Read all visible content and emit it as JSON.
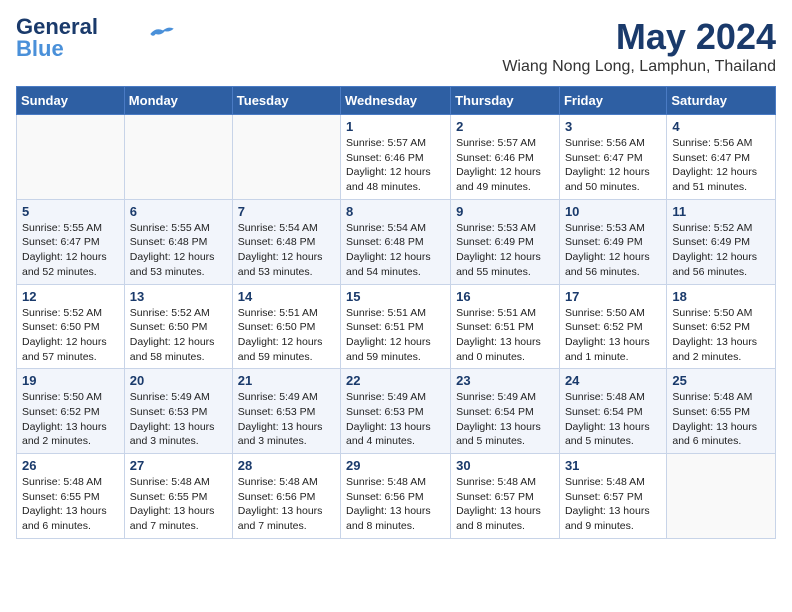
{
  "logo": {
    "line1": "General",
    "line2": "Blue"
  },
  "title": "May 2024",
  "location": "Wiang Nong Long, Lamphun, Thailand",
  "weekdays": [
    "Sunday",
    "Monday",
    "Tuesday",
    "Wednesday",
    "Thursday",
    "Friday",
    "Saturday"
  ],
  "weeks": [
    [
      {
        "day": "",
        "info": ""
      },
      {
        "day": "",
        "info": ""
      },
      {
        "day": "",
        "info": ""
      },
      {
        "day": "1",
        "info": "Sunrise: 5:57 AM\nSunset: 6:46 PM\nDaylight: 12 hours\nand 48 minutes."
      },
      {
        "day": "2",
        "info": "Sunrise: 5:57 AM\nSunset: 6:46 PM\nDaylight: 12 hours\nand 49 minutes."
      },
      {
        "day": "3",
        "info": "Sunrise: 5:56 AM\nSunset: 6:47 PM\nDaylight: 12 hours\nand 50 minutes."
      },
      {
        "day": "4",
        "info": "Sunrise: 5:56 AM\nSunset: 6:47 PM\nDaylight: 12 hours\nand 51 minutes."
      }
    ],
    [
      {
        "day": "5",
        "info": "Sunrise: 5:55 AM\nSunset: 6:47 PM\nDaylight: 12 hours\nand 52 minutes."
      },
      {
        "day": "6",
        "info": "Sunrise: 5:55 AM\nSunset: 6:48 PM\nDaylight: 12 hours\nand 53 minutes."
      },
      {
        "day": "7",
        "info": "Sunrise: 5:54 AM\nSunset: 6:48 PM\nDaylight: 12 hours\nand 53 minutes."
      },
      {
        "day": "8",
        "info": "Sunrise: 5:54 AM\nSunset: 6:48 PM\nDaylight: 12 hours\nand 54 minutes."
      },
      {
        "day": "9",
        "info": "Sunrise: 5:53 AM\nSunset: 6:49 PM\nDaylight: 12 hours\nand 55 minutes."
      },
      {
        "day": "10",
        "info": "Sunrise: 5:53 AM\nSunset: 6:49 PM\nDaylight: 12 hours\nand 56 minutes."
      },
      {
        "day": "11",
        "info": "Sunrise: 5:52 AM\nSunset: 6:49 PM\nDaylight: 12 hours\nand 56 minutes."
      }
    ],
    [
      {
        "day": "12",
        "info": "Sunrise: 5:52 AM\nSunset: 6:50 PM\nDaylight: 12 hours\nand 57 minutes."
      },
      {
        "day": "13",
        "info": "Sunrise: 5:52 AM\nSunset: 6:50 PM\nDaylight: 12 hours\nand 58 minutes."
      },
      {
        "day": "14",
        "info": "Sunrise: 5:51 AM\nSunset: 6:50 PM\nDaylight: 12 hours\nand 59 minutes."
      },
      {
        "day": "15",
        "info": "Sunrise: 5:51 AM\nSunset: 6:51 PM\nDaylight: 12 hours\nand 59 minutes."
      },
      {
        "day": "16",
        "info": "Sunrise: 5:51 AM\nSunset: 6:51 PM\nDaylight: 13 hours\nand 0 minutes."
      },
      {
        "day": "17",
        "info": "Sunrise: 5:50 AM\nSunset: 6:52 PM\nDaylight: 13 hours\nand 1 minute."
      },
      {
        "day": "18",
        "info": "Sunrise: 5:50 AM\nSunset: 6:52 PM\nDaylight: 13 hours\nand 2 minutes."
      }
    ],
    [
      {
        "day": "19",
        "info": "Sunrise: 5:50 AM\nSunset: 6:52 PM\nDaylight: 13 hours\nand 2 minutes."
      },
      {
        "day": "20",
        "info": "Sunrise: 5:49 AM\nSunset: 6:53 PM\nDaylight: 13 hours\nand 3 minutes."
      },
      {
        "day": "21",
        "info": "Sunrise: 5:49 AM\nSunset: 6:53 PM\nDaylight: 13 hours\nand 3 minutes."
      },
      {
        "day": "22",
        "info": "Sunrise: 5:49 AM\nSunset: 6:53 PM\nDaylight: 13 hours\nand 4 minutes."
      },
      {
        "day": "23",
        "info": "Sunrise: 5:49 AM\nSunset: 6:54 PM\nDaylight: 13 hours\nand 5 minutes."
      },
      {
        "day": "24",
        "info": "Sunrise: 5:48 AM\nSunset: 6:54 PM\nDaylight: 13 hours\nand 5 minutes."
      },
      {
        "day": "25",
        "info": "Sunrise: 5:48 AM\nSunset: 6:55 PM\nDaylight: 13 hours\nand 6 minutes."
      }
    ],
    [
      {
        "day": "26",
        "info": "Sunrise: 5:48 AM\nSunset: 6:55 PM\nDaylight: 13 hours\nand 6 minutes."
      },
      {
        "day": "27",
        "info": "Sunrise: 5:48 AM\nSunset: 6:55 PM\nDaylight: 13 hours\nand 7 minutes."
      },
      {
        "day": "28",
        "info": "Sunrise: 5:48 AM\nSunset: 6:56 PM\nDaylight: 13 hours\nand 7 minutes."
      },
      {
        "day": "29",
        "info": "Sunrise: 5:48 AM\nSunset: 6:56 PM\nDaylight: 13 hours\nand 8 minutes."
      },
      {
        "day": "30",
        "info": "Sunrise: 5:48 AM\nSunset: 6:57 PM\nDaylight: 13 hours\nand 8 minutes."
      },
      {
        "day": "31",
        "info": "Sunrise: 5:48 AM\nSunset: 6:57 PM\nDaylight: 13 hours\nand 9 minutes."
      },
      {
        "day": "",
        "info": ""
      }
    ]
  ]
}
